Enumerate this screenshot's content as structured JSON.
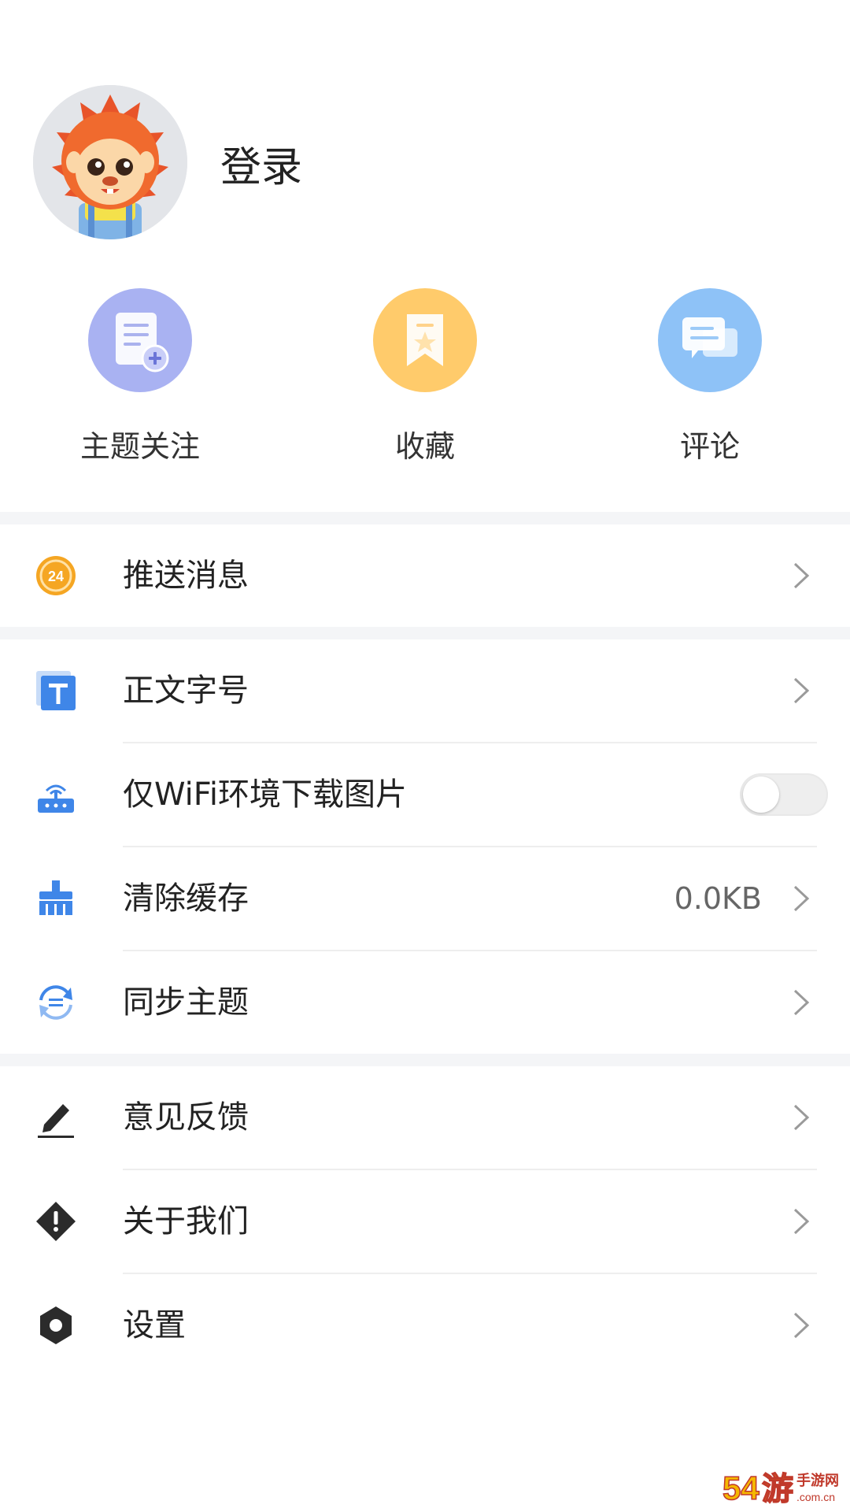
{
  "header": {
    "login_label": "登录"
  },
  "quick_actions": [
    {
      "label": "主题关注",
      "icon": "document-plus-icon",
      "color": "#a9b2f2"
    },
    {
      "label": "收藏",
      "icon": "bookmark-icon",
      "color": "#ffcb6b"
    },
    {
      "label": "评论",
      "icon": "comments-icon",
      "color": "#8ec2f7"
    }
  ],
  "menu": {
    "push": {
      "label": "推送消息",
      "icon": "clock-24-icon"
    },
    "font_size": {
      "label": "正文字号",
      "icon": "text-t-icon"
    },
    "wifi_images": {
      "label": "仅WiFi环境下载图片",
      "icon": "router-icon",
      "toggle_on": false
    },
    "clear_cache": {
      "label": "清除缓存",
      "icon": "broom-icon",
      "value": "0.0KB"
    },
    "sync_topics": {
      "label": "同步主题",
      "icon": "sync-icon"
    },
    "feedback": {
      "label": "意见反馈",
      "icon": "pencil-icon"
    },
    "about": {
      "label": "关于我们",
      "icon": "info-diamond-icon"
    },
    "settings": {
      "label": "设置",
      "icon": "gear-icon"
    }
  },
  "watermark": {
    "text": "54游 手游网 .com.cn"
  },
  "colors": {
    "accent_blue": "#3f86e8",
    "orange": "#f5a623",
    "divider": "#eeeeee",
    "band": "#f4f5f7"
  }
}
